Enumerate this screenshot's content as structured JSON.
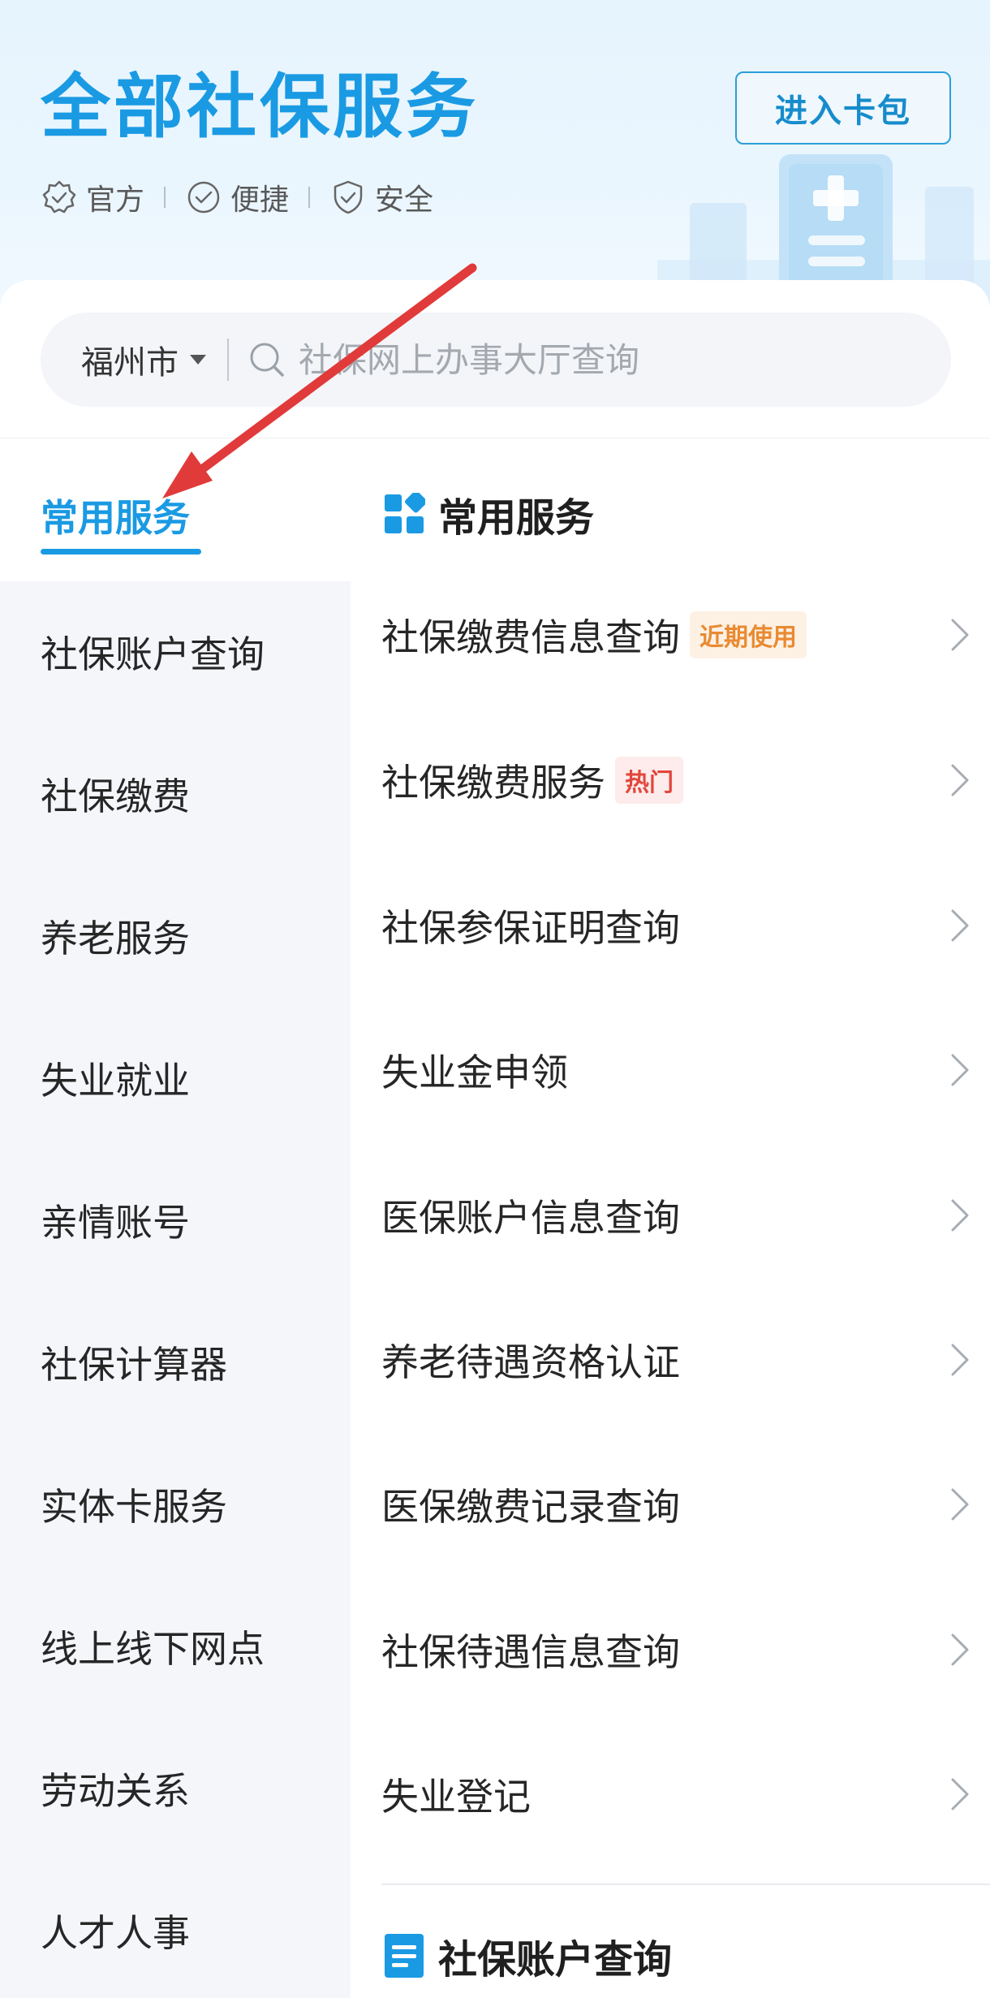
{
  "header": {
    "title": "全部社保服务",
    "badges": [
      "官方",
      "便捷",
      "安全"
    ],
    "wallet_button": "进入卡包"
  },
  "search": {
    "city": "福州市",
    "placeholder": "社保网上办事大厅查询"
  },
  "sidebar": {
    "items": [
      {
        "label": "常用服务",
        "active": true
      },
      {
        "label": "社保账户查询"
      },
      {
        "label": "社保缴费"
      },
      {
        "label": "养老服务"
      },
      {
        "label": "失业就业"
      },
      {
        "label": "亲情账号"
      },
      {
        "label": "社保计算器"
      },
      {
        "label": "实体卡服务"
      },
      {
        "label": "线上线下网点"
      },
      {
        "label": "劳动关系"
      },
      {
        "label": "人才人事"
      }
    ]
  },
  "sections": [
    {
      "title": "常用服务",
      "items": [
        {
          "label": "社保缴费信息查询",
          "tag": "近期使用"
        },
        {
          "label": "社保缴费服务",
          "tag": "热门"
        },
        {
          "label": "社保参保证明查询"
        },
        {
          "label": "失业金申领"
        },
        {
          "label": "医保账户信息查询"
        },
        {
          "label": "养老待遇资格认证"
        },
        {
          "label": "医保缴费记录查询"
        },
        {
          "label": "社保待遇信息查询"
        },
        {
          "label": "失业登记"
        }
      ]
    },
    {
      "title": "社保账户查询"
    }
  ],
  "colors": {
    "accent": "#1a9ae3",
    "tag_recent": "#e98a32",
    "tag_hot": "#e2463c",
    "annotation_arrow": "#e03a3a"
  }
}
